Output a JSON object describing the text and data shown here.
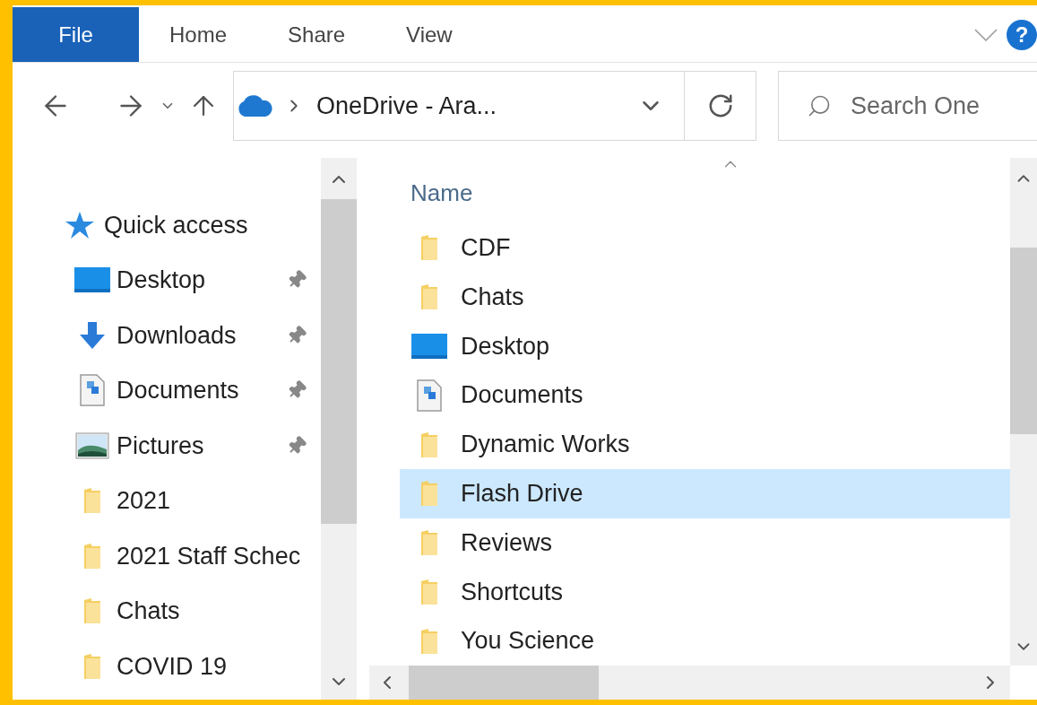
{
  "ribbon": {
    "tabs": [
      {
        "label": "File",
        "selected": true
      },
      {
        "label": "Home",
        "selected": false
      },
      {
        "label": "Share",
        "selected": false
      },
      {
        "label": "View",
        "selected": false
      }
    ],
    "help": "?"
  },
  "address_bar": {
    "path": "OneDrive - Ara...",
    "search": {
      "placeholder": "Search One"
    }
  },
  "navigation_pane": {
    "items": [
      {
        "label": "Quick access",
        "kind": "star",
        "children": [
          {
            "label": "Desktop",
            "kind": "desktop",
            "pinned": true
          },
          {
            "label": "Downloads",
            "kind": "download",
            "pinned": true
          },
          {
            "label": "Documents",
            "kind": "document",
            "pinned": true
          },
          {
            "label": "Pictures",
            "kind": "pictures",
            "pinned": true
          },
          {
            "label": "2021",
            "kind": "folder",
            "pinned": false
          },
          {
            "label": "2021 Staff Schec",
            "kind": "folder",
            "pinned": false
          },
          {
            "label": "Chats",
            "kind": "folder",
            "pinned": false
          },
          {
            "label": "COVID 19",
            "kind": "folder",
            "pinned": false
          }
        ]
      }
    ]
  },
  "file_list": {
    "columns": [
      "Name"
    ],
    "rows": [
      {
        "name": "CDF",
        "kind": "folder",
        "selected": false
      },
      {
        "name": "Chats",
        "kind": "folder",
        "selected": false
      },
      {
        "name": "Desktop",
        "kind": "desktop",
        "selected": false
      },
      {
        "name": "Documents",
        "kind": "document",
        "selected": false
      },
      {
        "name": "Dynamic Works",
        "kind": "folder",
        "selected": false
      },
      {
        "name": "Flash Drive",
        "kind": "folder",
        "selected": true
      },
      {
        "name": "Reviews",
        "kind": "folder",
        "selected": false
      },
      {
        "name": "Shortcuts",
        "kind": "folder",
        "selected": false
      },
      {
        "name": "You Science",
        "kind": "folder",
        "selected": false
      }
    ]
  }
}
